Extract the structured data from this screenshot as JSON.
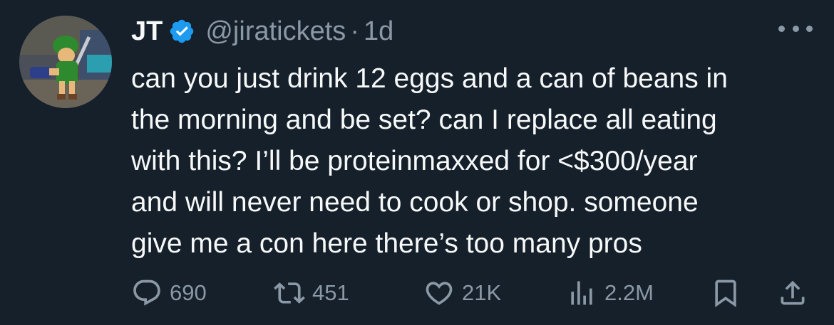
{
  "tweet": {
    "display_name": "JT",
    "handle": "@jiratickets",
    "separator": "·",
    "time": "1d",
    "text": "can you just drink 12 eggs and a can of beans in\nthe morning and be set? can I replace all eating\nwith this? I’ll be proteinmaxxed for <$300/year\nand will never need to cook or shop. someone\ngive me a con here there’s too many pros"
  },
  "actions": {
    "replies": "690",
    "retweets": "451",
    "likes": "21K",
    "views": "2.2M"
  },
  "icons": {
    "avatar": "avatar-image",
    "verified": "verified-badge-icon",
    "more": "more-icon",
    "reply": "reply-icon",
    "retweet": "retweet-icon",
    "like": "heart-icon",
    "views": "views-icon",
    "bookmark": "bookmark-icon",
    "share": "share-icon"
  },
  "colors": {
    "background": "#15202b",
    "text": "#f7f9f9",
    "muted": "#8b98a5",
    "verified": "#1d9bf0"
  }
}
